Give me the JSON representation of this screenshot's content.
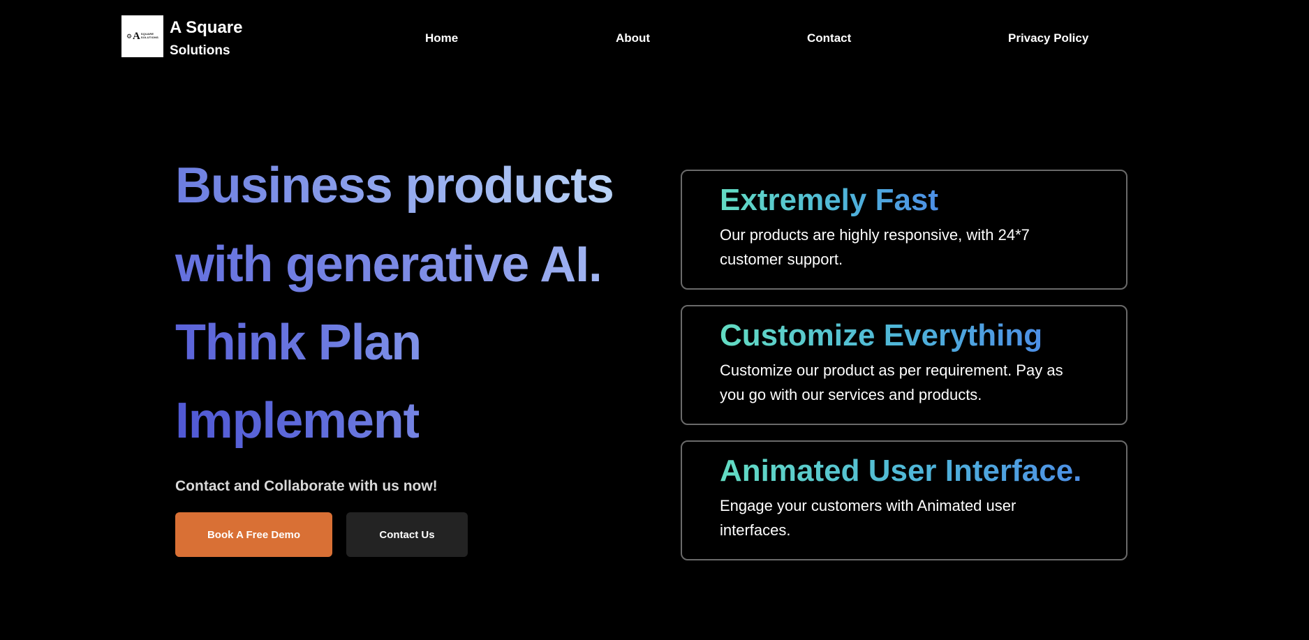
{
  "brand": {
    "line1": "A Square",
    "line2": "Solutions",
    "logo": {
      "initial": "A",
      "small_top": "SQUARE",
      "small_bottom": "SOLUTIONS",
      "icon": "gear-icon"
    }
  },
  "nav": {
    "items": [
      {
        "label": "Home"
      },
      {
        "label": "About"
      },
      {
        "label": "Contact"
      },
      {
        "label": "Privacy Policy"
      }
    ]
  },
  "hero": {
    "lines": [
      "Business products",
      "with generative AI.",
      "Think Plan",
      "Implement"
    ],
    "tagline": "Contact and Collaborate with us now!",
    "primary_button": "Book A Free Demo",
    "secondary_button": "Contact Us"
  },
  "features": [
    {
      "title": "Extremely Fast",
      "description": "Our products are highly responsive, with 24*7 customer support."
    },
    {
      "title": "Customize Everything",
      "description": "Customize our product as per requirement. Pay as you go with our services and products."
    },
    {
      "title": "Animated User Interface.",
      "description": "Engage your customers with Animated user interfaces."
    }
  ],
  "colors": {
    "background": "#000000",
    "primary_button": "#d97035",
    "secondary_button": "#232323",
    "hero_gradient_start": "#5b63d9",
    "hero_gradient_end": "#b9d3f7",
    "feature_gradient_start": "#63dcc2",
    "feature_gradient_end": "#4d8fe6",
    "card_border": "#6a6a6a"
  }
}
